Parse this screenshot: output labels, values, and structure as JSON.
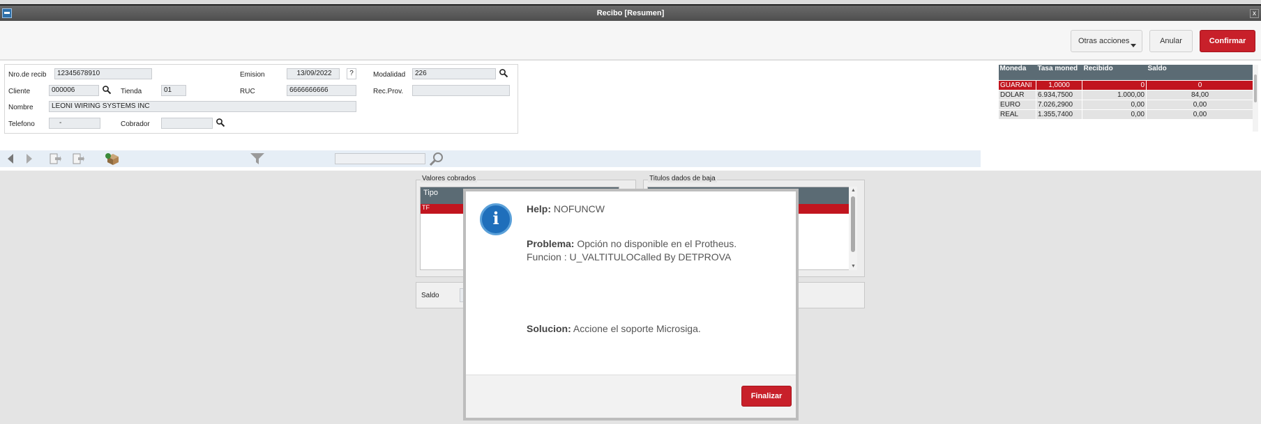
{
  "window": {
    "title": "Recibo [Resumen]",
    "close_glyph": "x"
  },
  "toolbar": {
    "more_label": "Otras acciones",
    "cancel_label": "Anular",
    "confirm_label": "Confirmar"
  },
  "form": {
    "receipt_no_label": "Nro.de recib",
    "receipt_no_value": "12345678910",
    "emission_label": "Emision",
    "emission_value": "13/09/2022",
    "modality_label": "Modalidad",
    "modality_value": "226",
    "client_label": "Cliente",
    "client_value": "000006",
    "store_label": "Tienda",
    "store_value": "01",
    "ruc_label": "RUC",
    "ruc_value": "6666666666",
    "recprov_label": "Rec.Prov.",
    "recprov_value": "",
    "name_label": "Nombre",
    "name_value": "LEONI WIRING SYSTEMS INC",
    "phone_label": "Telefono",
    "phone_value": "-",
    "collector_label": "Cobrador",
    "collector_value": "",
    "help_glyph": "?"
  },
  "currency_grid": {
    "headers": [
      "Moneda",
      "Tasa moned",
      "Recibido",
      "Saldo"
    ],
    "rows": [
      [
        "GUARANI",
        "1,0000",
        "0",
        "0"
      ],
      [
        "DOLAR",
        "6.934,7500",
        "1.000,00",
        "84,00"
      ],
      [
        "EURO",
        "7.026,2900",
        "0,00",
        "0,00"
      ],
      [
        "REAL",
        "1.355,7400",
        "0,00",
        "0,00"
      ]
    ]
  },
  "panels": {
    "collected_title": "Valores cobrados",
    "collected_col": "Tipo",
    "collected_row": "TF",
    "titles_title": "Titulos dados de baja",
    "balance_label": "Saldo"
  },
  "modal": {
    "help_label": "Help:",
    "help_value": "NOFUNCW",
    "problem_label": "Problema:",
    "problem_value": "Opción no disponible en el Protheus.",
    "problem_line2": "Funcion : U_VALTITULOCalled By DETPROVA",
    "solution_label": "Solucion:",
    "solution_value": "Accione el soporte Microsiga.",
    "finish_label": "Finalizar",
    "info_glyph": "i"
  },
  "colors": {
    "accent_red": "#c8202a",
    "grid_header": "#5b6b74",
    "info_blue": "#1f6fbb"
  },
  "icons": [
    "window-icon",
    "close-icon",
    "search-icon",
    "prev-icon",
    "next-icon",
    "doc-in-icon",
    "doc-out-icon",
    "box-icon",
    "filter-icon",
    "info-icon"
  ]
}
